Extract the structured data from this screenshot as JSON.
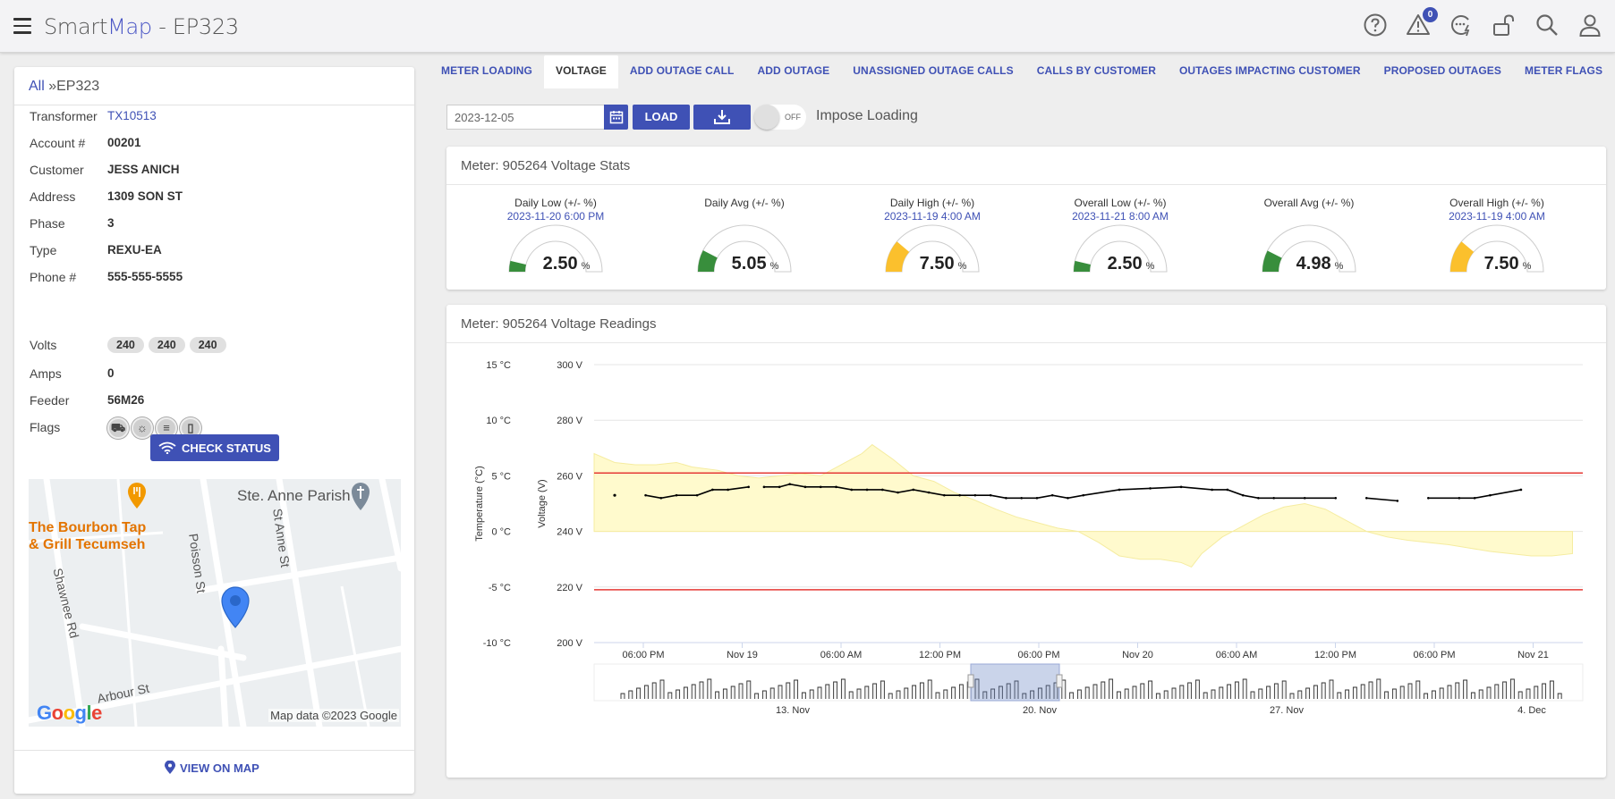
{
  "header": {
    "title_prefix": "Smart",
    "title_accent": "Map",
    "title_suffix": " - EP323",
    "notification_count": "0"
  },
  "left": {
    "breadcrumb_link": "All",
    "breadcrumb_current": "»EP323",
    "details": [
      {
        "label": "Transformer",
        "value": "TX10513",
        "link": true
      },
      {
        "label": "Account #",
        "value": "00201"
      },
      {
        "label": "Customer",
        "value": "JESS  ANICH"
      },
      {
        "label": "Address",
        "value": "1309  SON ST"
      },
      {
        "label": "Phase",
        "value": "3"
      },
      {
        "label": "Type",
        "value": "REXU-EA"
      },
      {
        "label": "Phone #",
        "value": "555-555-5555"
      }
    ],
    "volts_label": "Volts",
    "volts": [
      "240",
      "240",
      "240"
    ],
    "amps_label": "Amps",
    "amps": "0",
    "feeder_label": "Feeder",
    "feeder": "56M26",
    "flags_label": "Flags",
    "flags": [
      "car-flag-icon",
      "sun-flag-icon",
      "meter-flag-icon",
      "battery-flag-icon"
    ],
    "check_status": "CHECK STATUS",
    "view_on_map": "VIEW ON MAP",
    "map": {
      "poi_1": "Ste. Anne Parish",
      "poi_2": "The Bourbon Tap",
      "poi_3": "& Grill Tecumseh",
      "street_1": "Poisson St",
      "street_2": "St Anne St",
      "street_3": "Shawnee Rd",
      "street_4": "Arbour St",
      "logo": "Google",
      "attribution": "Map data ©2023 Google"
    }
  },
  "tabs": [
    {
      "label": "METER LOADING",
      "active": false
    },
    {
      "label": "VOLTAGE",
      "active": true
    },
    {
      "label": "ADD OUTAGE CALL",
      "active": false
    },
    {
      "label": "ADD OUTAGE",
      "active": false
    },
    {
      "label": "UNASSIGNED OUTAGE CALLS",
      "active": false
    },
    {
      "label": "CALLS BY CUSTOMER",
      "active": false
    },
    {
      "label": "OUTAGES IMPACTING CUSTOMER",
      "active": false
    },
    {
      "label": "PROPOSED OUTAGES",
      "active": false
    },
    {
      "label": "METER FLAGS",
      "active": false
    }
  ],
  "controls": {
    "date_value": "2023-12-05",
    "load_label": "LOAD",
    "toggle_state": "OFF",
    "impose_label": "Impose Loading"
  },
  "stats": {
    "title": "Meter: 905264 Voltage Stats",
    "gauges": [
      {
        "title": "Daily Low (+/- %)",
        "date": "2023-11-20 6:00 PM",
        "value": "2.50",
        "unit": "%",
        "level": 0.167,
        "color": "#388e3c"
      },
      {
        "title": "Daily Avg (+/- %)",
        "date": "",
        "value": "5.05",
        "unit": "%",
        "level": 0.337,
        "color": "#388e3c"
      },
      {
        "title": "Daily High (+/- %)",
        "date": "2023-11-19 4:00 AM",
        "value": "7.50",
        "unit": "%",
        "level": 0.5,
        "color": "#fbc02d"
      },
      {
        "title": "Overall Low (+/- %)",
        "date": "2023-11-21 8:00 AM",
        "value": "2.50",
        "unit": "%",
        "level": 0.167,
        "color": "#388e3c"
      },
      {
        "title": "Overall Avg (+/- %)",
        "date": "",
        "value": "4.98",
        "unit": "%",
        "level": 0.332,
        "color": "#388e3c"
      },
      {
        "title": "Overall High (+/- %)",
        "date": "2023-11-19 4:00 AM",
        "value": "7.50",
        "unit": "%",
        "level": 0.5,
        "color": "#fbc02d"
      }
    ]
  },
  "readings": {
    "title": "Meter: 905264 Voltage Readings"
  },
  "chart_data": {
    "type": "line",
    "title": "",
    "ylabel_left": "Temperature (°C)",
    "ylabel_right": "Voltage (V)",
    "temp_ticks": [
      "15 °C",
      "10 °C",
      "5 °C",
      "0 °C",
      "-5 °C",
      "-10 °C"
    ],
    "volt_ticks": [
      "300 V",
      "280 V",
      "260 V",
      "240 V",
      "220 V",
      "200 V"
    ],
    "temp_range": [
      -10,
      15
    ],
    "volt_range": [
      200,
      300
    ],
    "x_ticks": [
      "06:00 PM",
      "Nov 19",
      "06:00 AM",
      "12:00 PM",
      "06:00 PM",
      "Nov 20",
      "06:00 AM",
      "12:00 PM",
      "06:00 PM",
      "Nov 21"
    ],
    "x_range_hours": [
      -9,
      87
    ],
    "limits_v": [
      261,
      219
    ],
    "limit_color": "#e53935",
    "navigator_ticks": [
      "13. Nov",
      "20. Nov",
      "27. Nov",
      "4. Dec"
    ],
    "voltage_series": {
      "name": "Voltage",
      "color": "#000000",
      "points": [
        [
          -7,
          253
        ],
        [
          -4,
          253
        ],
        [
          -2.5,
          252
        ],
        [
          -1,
          253
        ],
        [
          1,
          253
        ],
        [
          2.5,
          255
        ],
        [
          4,
          255
        ],
        [
          6,
          256
        ],
        [
          7.5,
          256
        ],
        [
          9,
          256
        ],
        [
          10,
          257
        ],
        [
          11.5,
          256
        ],
        [
          13,
          256
        ],
        [
          14.5,
          256
        ],
        [
          16,
          255
        ],
        [
          17.5,
          255
        ],
        [
          19,
          255
        ],
        [
          20.5,
          254
        ],
        [
          22,
          255
        ],
        [
          23.5,
          254
        ],
        [
          25,
          253
        ],
        [
          26.5,
          253
        ],
        [
          28,
          253
        ],
        [
          29.5,
          253
        ],
        [
          31,
          252
        ],
        [
          32.5,
          252
        ],
        [
          34,
          252
        ],
        [
          35.5,
          253
        ],
        [
          37,
          252
        ],
        [
          38.5,
          253
        ],
        [
          42,
          255
        ],
        [
          45,
          255.5
        ],
        [
          48,
          256
        ],
        [
          51,
          255
        ],
        [
          52.5,
          255
        ],
        [
          54,
          253
        ],
        [
          55.5,
          252
        ],
        [
          57,
          252
        ],
        [
          60,
          252
        ],
        [
          63,
          252
        ],
        [
          66,
          252
        ],
        [
          69,
          251
        ],
        [
          72,
          252
        ],
        [
          75,
          252
        ],
        [
          76.5,
          252
        ],
        [
          78,
          253
        ],
        [
          81,
          255
        ]
      ],
      "segments": [
        [
          1,
          7
        ],
        [
          8,
          39
        ],
        [
          40,
          41
        ],
        [
          42,
          46
        ],
        [
          51,
          53
        ]
      ]
    },
    "temperature_series": {
      "name": "Temperature",
      "color": "#fff9c4",
      "points": [
        [
          -9,
          7
        ],
        [
          -7,
          6.2
        ],
        [
          -5,
          6
        ],
        [
          -3,
          6
        ],
        [
          -1,
          6.2
        ],
        [
          0.5,
          5.8
        ],
        [
          3,
          5.5
        ],
        [
          5,
          5
        ],
        [
          7,
          4.8
        ],
        [
          9,
          5
        ],
        [
          11,
          5.2
        ],
        [
          13,
          5
        ],
        [
          15,
          6
        ],
        [
          17,
          7
        ],
        [
          18,
          7.8
        ],
        [
          20,
          6.5
        ],
        [
          22,
          5
        ],
        [
          24,
          4.5
        ],
        [
          26,
          3.5
        ],
        [
          28,
          2.8
        ],
        [
          30,
          2
        ],
        [
          32,
          1.3
        ],
        [
          34,
          0.8
        ],
        [
          36,
          0.3
        ],
        [
          38,
          0
        ],
        [
          40,
          -1
        ],
        [
          42,
          -2.2
        ],
        [
          44,
          -2.5
        ],
        [
          46,
          -2.5
        ],
        [
          48,
          -2.8
        ],
        [
          49,
          -3.2
        ],
        [
          50,
          -2
        ],
        [
          52,
          -0.5
        ],
        [
          54,
          0.5
        ],
        [
          56,
          1.5
        ],
        [
          58,
          2.2
        ],
        [
          60,
          2.5
        ],
        [
          62,
          2
        ],
        [
          64,
          1
        ],
        [
          66,
          0
        ],
        [
          68,
          -0.5
        ],
        [
          70,
          -0.8
        ],
        [
          72,
          -1
        ],
        [
          74,
          -1.2
        ],
        [
          76,
          -1.5
        ],
        [
          78,
          -1.8
        ],
        [
          80,
          -2
        ],
        [
          82,
          -2.2
        ],
        [
          84,
          -2.2
        ],
        [
          86,
          -2
        ]
      ]
    }
  }
}
